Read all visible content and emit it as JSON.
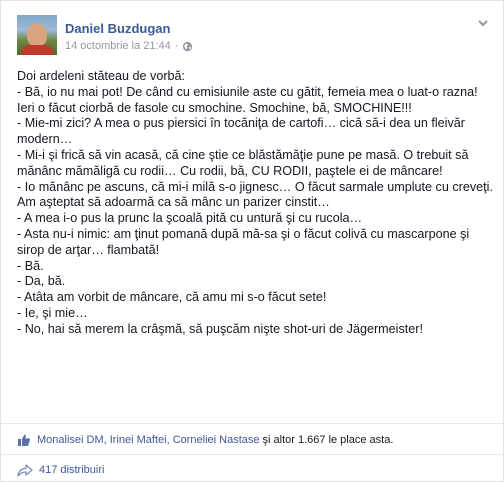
{
  "post": {
    "author": "Daniel Buzdugan",
    "timestamp": "14 octombrie la 21:44",
    "separator": "·",
    "lines": [
      "Doi ardeleni stăteau de vorbă:",
      "- Bă, io nu mai pot! De când cu emisiunile aste cu gătit, femeia mea o luat-o razna! Ieri o făcut ciorbă de fasole cu smochine. Smochine, bă, SMOCHINE!!!",
      "- Mie-mi zici? A mea o pus piersici în tocăniţa de cartofi… cică să-i dea un fleivăr modern…",
      "- Mi-i şi frică să vin acasă, că cine ştie ce blăstămăţie pune pe masă. O trebuit să mănânc mămăligă cu rodii… Cu rodii, bă, CU RODII, paştele ei de mâncare!",
      "- Io mănânc pe ascuns, că mi-i milă s-o jignesc… O făcut sarmale umplute cu creveţi. Am aşteptat să adoarmă ca să mânc un parizer cinstit…",
      "- A mea i-o pus la prunc la şcoală pită cu untură şi cu rucola…",
      "- Asta nu-i nimic: am ţinut pomană după mă-sa şi o făcut colivă cu mascarpone şi sirop de arţar… flambată!",
      "- Bă.",
      "- Da, bă.",
      "- Atâta am vorbit de mâncare, că amu mi s-o făcut sete!",
      "- Ie, şi mie…",
      "- No, hai să merem la crâşmă, să puşcăm nişte shot-uri de Jägermeister!"
    ]
  },
  "likes": {
    "names": "Monalisei DM, Irinei Maftei, Corneliei Nastase",
    "rest": "şi altor 1.667 le place asta."
  },
  "shares": {
    "label": "417 distribuiri"
  },
  "icons": {
    "globe": "globe-icon",
    "chevron": "chevron-down-icon",
    "like": "like-icon",
    "share": "share-icon"
  },
  "colors": {
    "link": "#3b5998",
    "meta": "#9197a3",
    "text": "#141823"
  }
}
